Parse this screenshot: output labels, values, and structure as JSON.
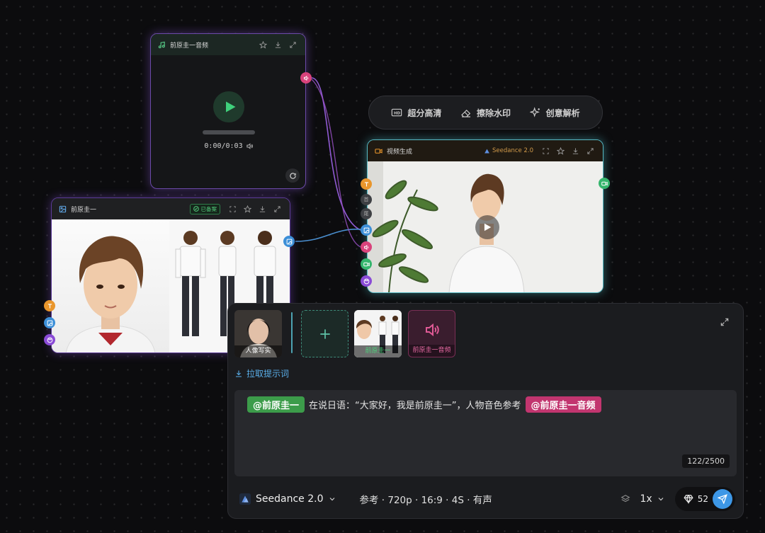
{
  "audio_node": {
    "title": "前原圭一音频",
    "time": "0:00/0:03",
    "progress": 0
  },
  "character_node": {
    "title": "前原圭一",
    "badge": "已备案"
  },
  "video_node": {
    "title": "视频生成",
    "model": "Seedance 2.0",
    "port_labels": [
      "首",
      "尾"
    ]
  },
  "toolbar": {
    "hd_label": "超分高清",
    "watermark_label": "擦除水印",
    "analyze_label": "创意解析"
  },
  "prompt_panel": {
    "thumbs": [
      {
        "label": "人像写实"
      },
      {
        "label": "前原圭一"
      },
      {
        "label": "前原圭一音频"
      }
    ],
    "pull_prompt_label": "拉取提示词",
    "mention_1": "@前原圭一",
    "text_mid": "在说日语：“大家好，我是前原圭一”，人物音色参考",
    "mention_2": "@前原圭一音频",
    "char_count": "122/2500",
    "model_label": "Seedance 2.0",
    "params": "参考 · 720p · 16:9 · 4S · 有声",
    "count": "1x",
    "credits": "52"
  },
  "colors": {
    "accent_green": "#3c9c4a",
    "accent_pink": "#c2356f",
    "send_blue": "#3d97e6",
    "video_border": "#56b9c4",
    "audio_border": "#6b4aa8"
  },
  "icons": [
    "music-icon",
    "star-icon",
    "download-icon",
    "expand-icon",
    "play-icon",
    "volume-icon",
    "refresh-icon",
    "image-icon",
    "check-circle-icon",
    "crop-icon",
    "video-icon",
    "hd-icon",
    "eraser-icon",
    "sparkle-icon",
    "text-icon",
    "palette-icon",
    "plus-icon",
    "import-icon",
    "seedance-logo-icon",
    "layers-icon",
    "chevron-down-icon",
    "gem-icon",
    "send-icon"
  ]
}
